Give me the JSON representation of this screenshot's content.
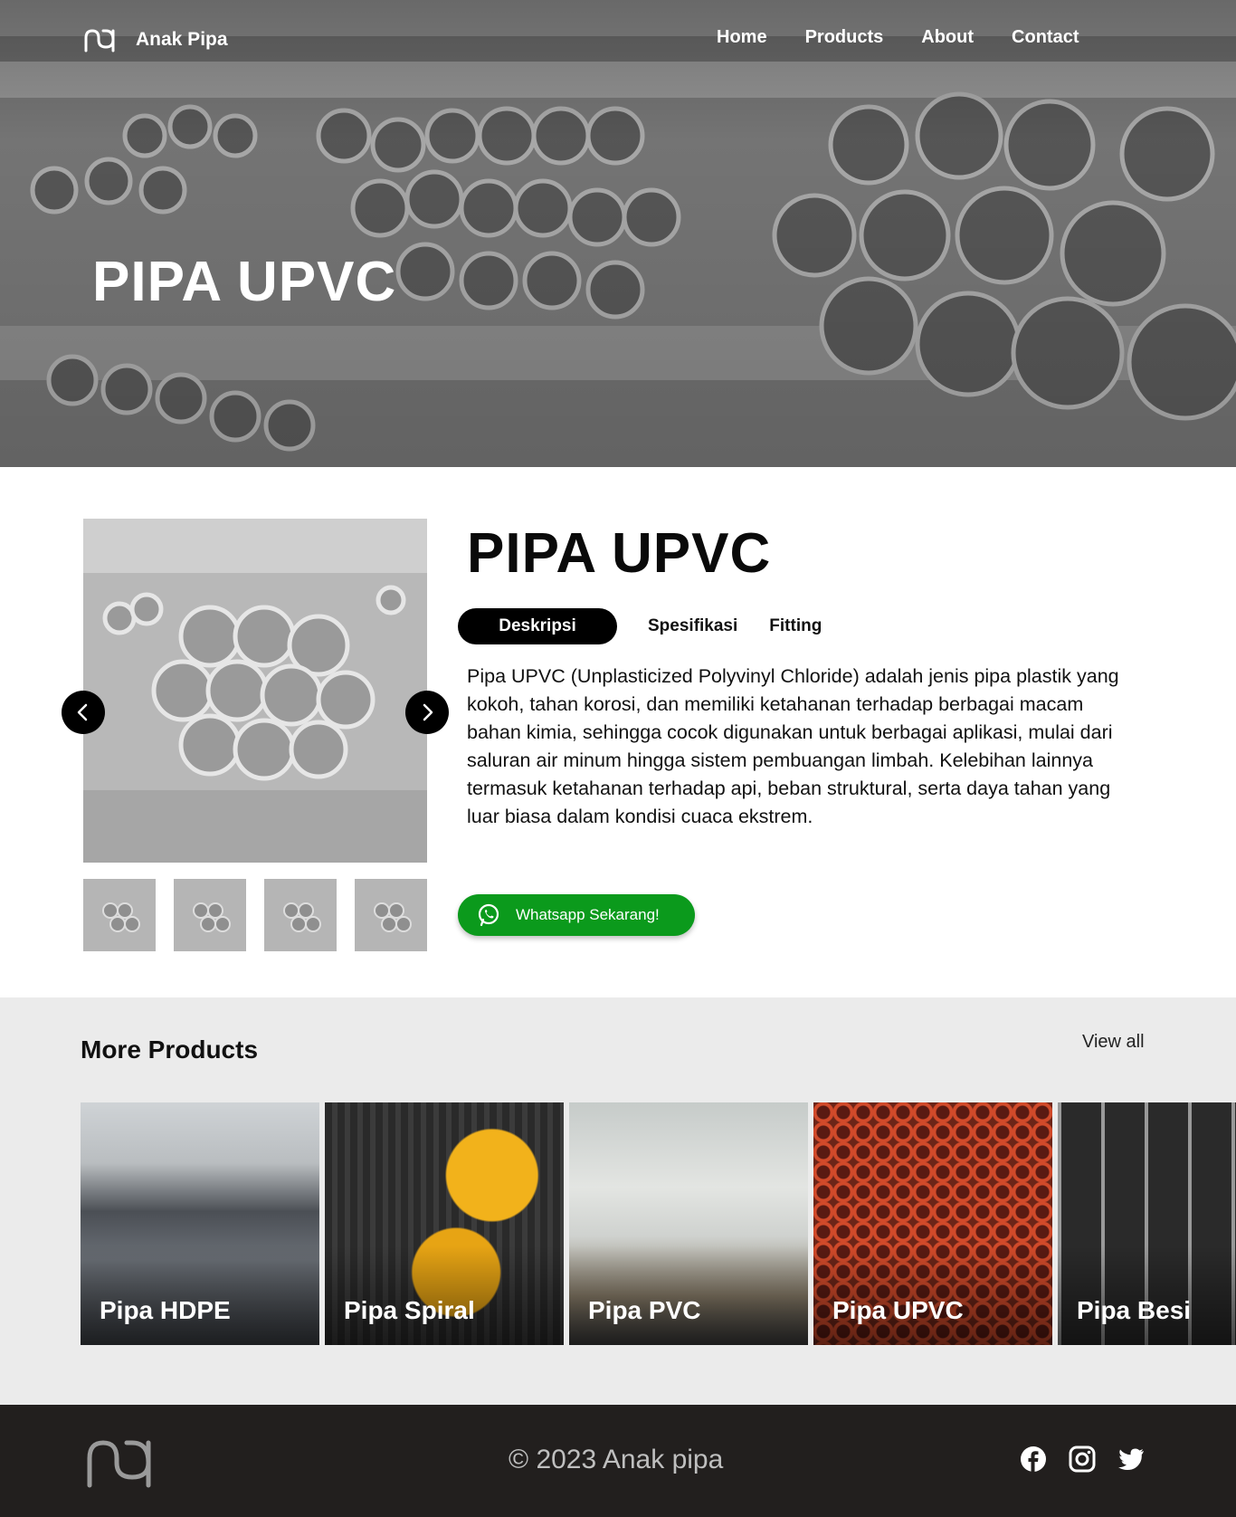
{
  "brand": {
    "name": "Anak Pipa"
  },
  "nav": {
    "items": [
      {
        "label": "Home"
      },
      {
        "label": "Products"
      },
      {
        "label": "About"
      },
      {
        "label": "Contact"
      }
    ]
  },
  "hero": {
    "title": "PIPA UPVC"
  },
  "product": {
    "title": "PIPA UPVC",
    "tabs": [
      {
        "label": "Deskripsi",
        "active": true
      },
      {
        "label": "Spesifikasi",
        "active": false
      },
      {
        "label": "Fitting",
        "active": false
      }
    ],
    "description": "Pipa UPVC (Unplasticized Polyvinyl Chloride) adalah jenis pipa plastik yang kokoh, tahan korosi, dan memiliki ketahanan terhadap berbagai macam bahan kimia, sehingga cocok digunakan untuk berbagai aplikasi, mulai dari saluran air minum hingga sistem pembuangan limbah. Kelebihan lainnya termasuk ketahanan terhadap api, beban struktural, serta daya tahan yang luar biasa dalam kondisi cuaca ekstrem.",
    "whatsapp_label": "Whatsapp Sekarang!"
  },
  "more_products": {
    "title": "More Products",
    "view_all": "View all",
    "items": [
      {
        "label": "Pipa HDPE"
      },
      {
        "label": "Pipa Spiral"
      },
      {
        "label": "Pipa PVC"
      },
      {
        "label": "Pipa UPVC"
      },
      {
        "label": "Pipa Besi"
      }
    ]
  },
  "footer": {
    "copyright": "© 2023 Anak pipa",
    "social": [
      "facebook-icon",
      "instagram-icon",
      "twitter-icon"
    ]
  },
  "colors": {
    "accent_black": "#000000",
    "whatsapp_green": "#0b9a1c",
    "footer_bg": "#221f1e",
    "section_bg": "#ebebeb"
  }
}
